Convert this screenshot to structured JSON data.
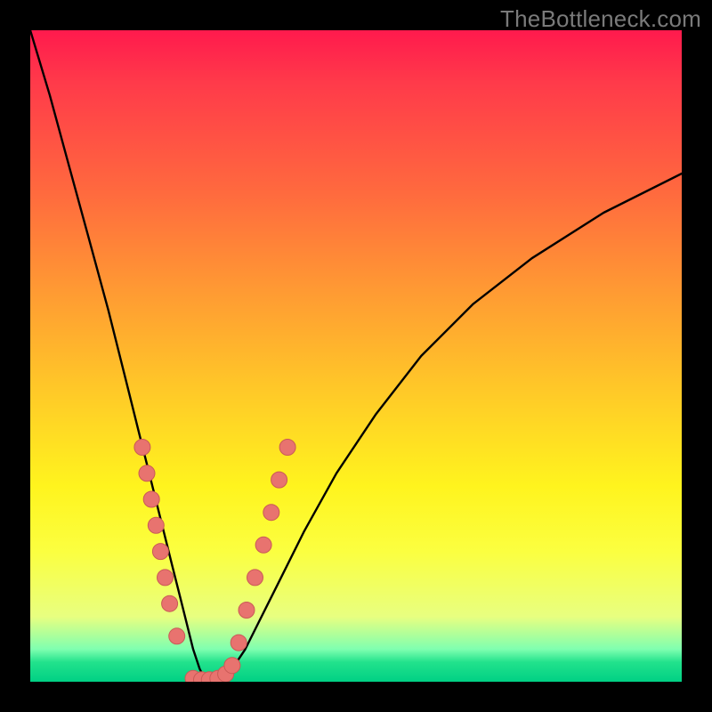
{
  "watermark": "TheBottleneck.com",
  "colors": {
    "curve_stroke": "#000000",
    "dot_fill": "#e8736f",
    "dot_stroke": "#c95a56"
  },
  "chart_data": {
    "type": "line",
    "title": "",
    "xlabel": "",
    "ylabel": "",
    "xlim": [
      0,
      100
    ],
    "ylim": [
      0,
      100
    ],
    "series": [
      {
        "name": "bottleneck-curve",
        "x": [
          0,
          3,
          6,
          9,
          12,
          15,
          17,
          18,
          19,
          20,
          21,
          22,
          23,
          24,
          25,
          26,
          27,
          28,
          29,
          30,
          31,
          33,
          35,
          38,
          42,
          47,
          53,
          60,
          68,
          77,
          88,
          100
        ],
        "y": [
          100,
          90,
          79,
          68,
          57,
          45,
          37,
          33,
          29,
          25,
          21,
          17,
          13,
          9,
          5,
          2,
          0,
          0,
          0,
          1,
          2,
          5,
          9,
          15,
          23,
          32,
          41,
          50,
          58,
          65,
          72,
          78
        ]
      }
    ],
    "markers": {
      "name": "highlight-dots",
      "points": [
        {
          "x": 17.2,
          "y": 36
        },
        {
          "x": 17.9,
          "y": 32
        },
        {
          "x": 18.6,
          "y": 28
        },
        {
          "x": 19.3,
          "y": 24
        },
        {
          "x": 20.0,
          "y": 20
        },
        {
          "x": 20.7,
          "y": 16
        },
        {
          "x": 21.4,
          "y": 12
        },
        {
          "x": 22.5,
          "y": 7
        },
        {
          "x": 25.0,
          "y": 0.5
        },
        {
          "x": 26.3,
          "y": 0.3
        },
        {
          "x": 27.5,
          "y": 0.3
        },
        {
          "x": 28.8,
          "y": 0.5
        },
        {
          "x": 30.0,
          "y": 1.2
        },
        {
          "x": 31.0,
          "y": 2.5
        },
        {
          "x": 32.0,
          "y": 6
        },
        {
          "x": 33.2,
          "y": 11
        },
        {
          "x": 34.5,
          "y": 16
        },
        {
          "x": 35.8,
          "y": 21
        },
        {
          "x": 37.0,
          "y": 26
        },
        {
          "x": 38.2,
          "y": 31
        },
        {
          "x": 39.5,
          "y": 36
        }
      ]
    }
  }
}
